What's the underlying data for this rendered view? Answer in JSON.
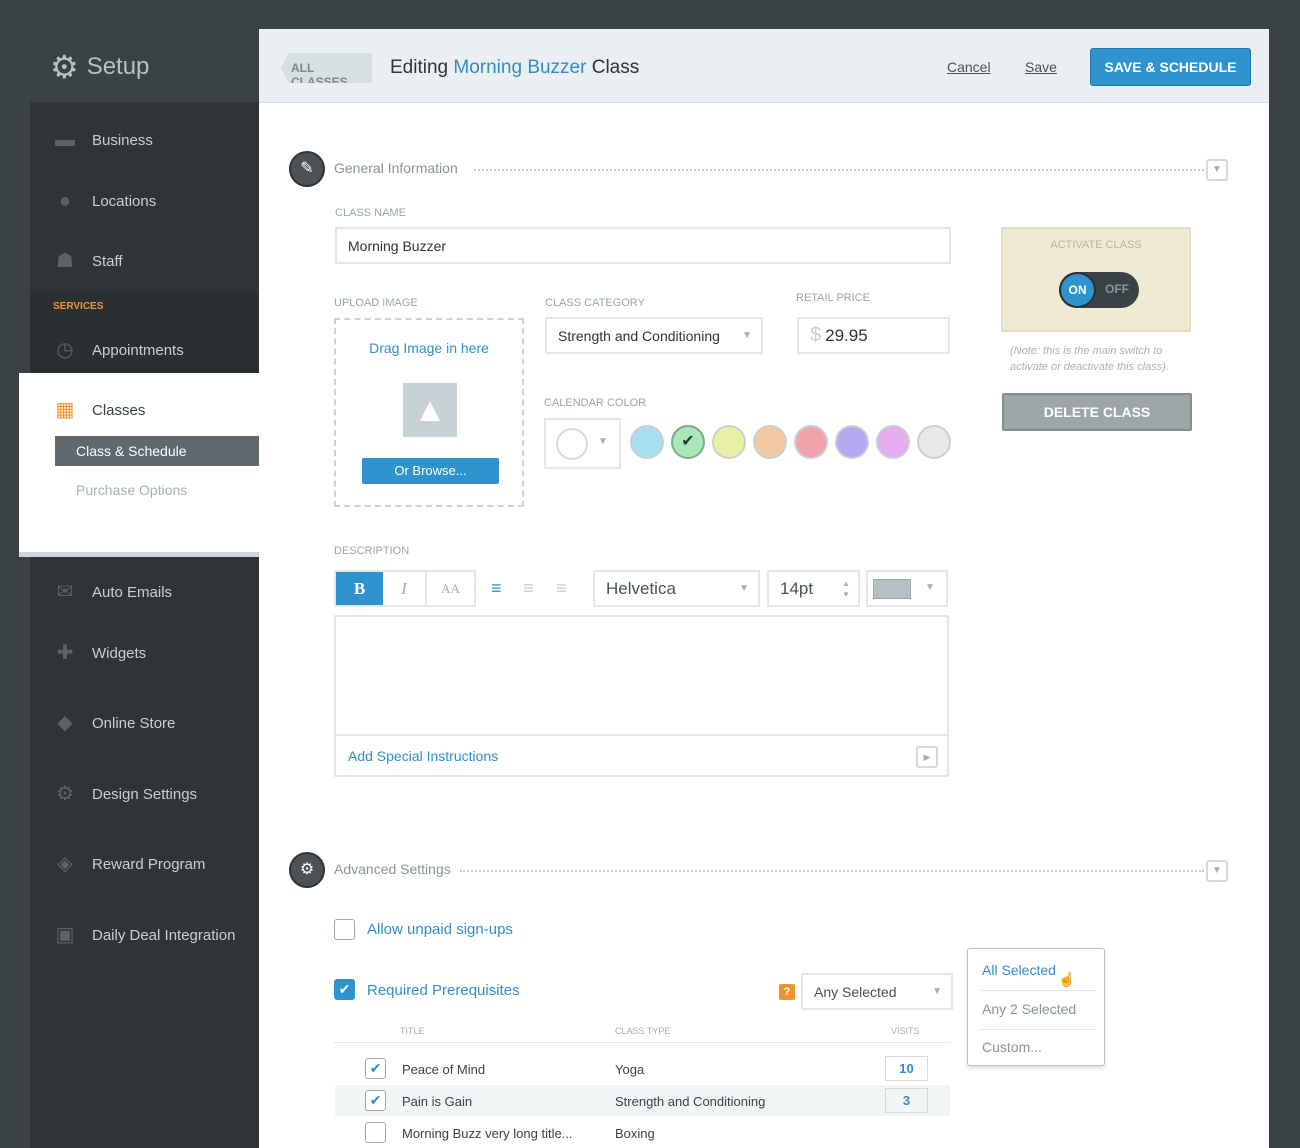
{
  "sidebar": {
    "title": "Setup",
    "items": [
      {
        "label": "Business",
        "icon": "briefcase-icon"
      },
      {
        "label": "Locations",
        "icon": "pin-icon"
      },
      {
        "label": "Staff",
        "icon": "people-icon"
      }
    ],
    "section": "SERVICES",
    "services": [
      {
        "label": "Appointments"
      },
      {
        "label": "Classes",
        "sub": [
          {
            "label": "Class & Schedule",
            "active": true
          },
          {
            "label": "Purchase Options"
          }
        ]
      },
      {
        "label": "Auto Emails"
      },
      {
        "label": "Widgets"
      },
      {
        "label": "Online Store"
      },
      {
        "label": "Design Settings"
      },
      {
        "label": "Reward Program"
      },
      {
        "label": "Daily Deal Integration"
      }
    ]
  },
  "header": {
    "back": "ALL CLASSES",
    "title_pre": "Editing",
    "title_name": "Morning Buzzer",
    "title_post": "Class",
    "cancel": "Cancel",
    "save": "Save",
    "save_schedule": "SAVE & SCHEDULE"
  },
  "general": {
    "heading": "General Information",
    "class_name_label": "CLASS NAME",
    "class_name": "Morning Buzzer",
    "upload_label": "UPLOAD IMAGE",
    "drag": "Drag Image in here",
    "browse": "Or Browse...",
    "category_label": "CLASS CATEGORY",
    "category": "Strength and Conditioning",
    "price_label": "RETAIL PRICE",
    "currency": "$",
    "price": "29.95",
    "color_label": "CALENDAR COLOR",
    "colors": [
      "#a6dff0",
      "#a9e8b6",
      "#e8efa6",
      "#f3c9a3",
      "#f0a3a8",
      "#b5aaf0",
      "#e7acf0",
      "#e8e8e8"
    ],
    "selected_color_index": 1,
    "activate_label": "ACTIVATE CLASS",
    "on": "ON",
    "off": "OFF",
    "activated": true,
    "note": "(Note: this is the main switch to activate or deactivate this class).",
    "delete": "DELETE CLASS",
    "description_label": "DESCRIPTION",
    "bold": "B",
    "italic": "I",
    "size_btn": "AA",
    "font": "Helvetica",
    "font_size": "14pt",
    "special": "Add Special Instructions"
  },
  "advanced": {
    "heading": "Advanced Settings",
    "allow_unpaid": "Allow unpaid sign-ups",
    "allow_unpaid_checked": false,
    "prereq": "Required Prerequisites",
    "prereq_checked": true,
    "help": "?",
    "select": "Any Selected",
    "options": [
      "All Selected",
      "Any 2 Selected",
      "Custom..."
    ],
    "columns": [
      "TITLE",
      "CLASS TYPE",
      "VISITS"
    ],
    "rows": [
      {
        "title": "Peace of Mind",
        "type": "Yoga",
        "visits": "10",
        "checked": true
      },
      {
        "title": "Pain is Gain",
        "type": "Strength and Conditioning",
        "visits": "3",
        "checked": true
      },
      {
        "title": "Morning Buzz very long title...",
        "type": "Boxing",
        "visits": "",
        "checked": false
      }
    ]
  }
}
